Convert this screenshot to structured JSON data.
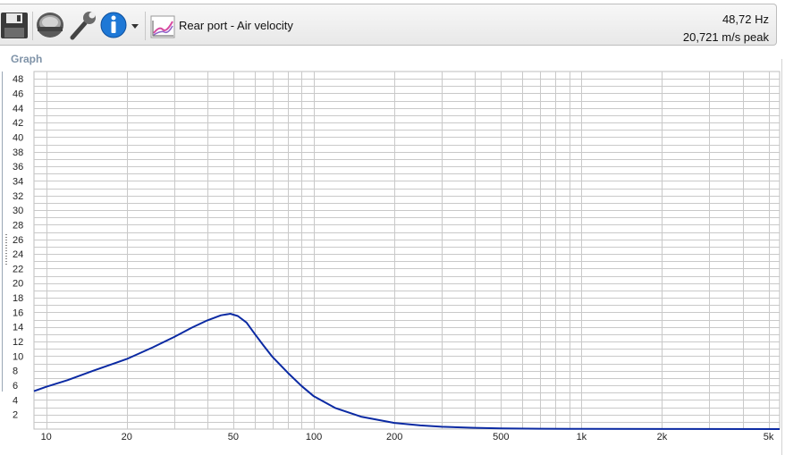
{
  "toolbar": {
    "icons": [
      "save-icon",
      "driver-icon",
      "wrench-icon",
      "info-icon",
      "dropdown-arrow-icon",
      "graph-icon"
    ],
    "graph_selector_label": "Rear port - Air velocity",
    "readout_frequency": "48,72 Hz",
    "readout_value": "20,721 m/s peak"
  },
  "panel": {
    "title": "Graph"
  },
  "colors": {
    "curve": "#0b2aa3",
    "grid": "#c9c9c9",
    "info_blue": "#1e78d6"
  },
  "chart_data": {
    "type": "line",
    "x_scale": "log",
    "y_scale": "linear",
    "xlim": [
      9,
      5500
    ],
    "ylim": [
      0,
      49
    ],
    "x_ticks": [
      10,
      20,
      50,
      100,
      200,
      500,
      1000,
      2000,
      5000
    ],
    "x_tick_labels": [
      "10",
      "20",
      "50",
      "100",
      "200",
      "500",
      "1k",
      "2k",
      "5k"
    ],
    "y_ticks": [
      2,
      4,
      6,
      8,
      10,
      12,
      14,
      16,
      18,
      20,
      22,
      24,
      26,
      28,
      30,
      32,
      34,
      36,
      38,
      40,
      42,
      44,
      46,
      48
    ],
    "grid": true,
    "series": [
      {
        "x": [
          9,
          10,
          12,
          15,
          20,
          25,
          30,
          35,
          40,
          45,
          48.72,
          52,
          56,
          60,
          65,
          70,
          80,
          90,
          100,
          120,
          150,
          200,
          250,
          300,
          400,
          500,
          700,
          1000,
          2000,
          5500
        ],
        "y": [
          5.2,
          5.8,
          6.7,
          8.0,
          9.6,
          11.2,
          12.6,
          13.9,
          14.9,
          15.6,
          15.8,
          15.5,
          14.6,
          13.1,
          11.4,
          9.9,
          7.7,
          5.9,
          4.5,
          2.9,
          1.7,
          0.85,
          0.5,
          0.32,
          0.17,
          0.1,
          0.05,
          0.03,
          0.01,
          0.0
        ]
      }
    ]
  }
}
